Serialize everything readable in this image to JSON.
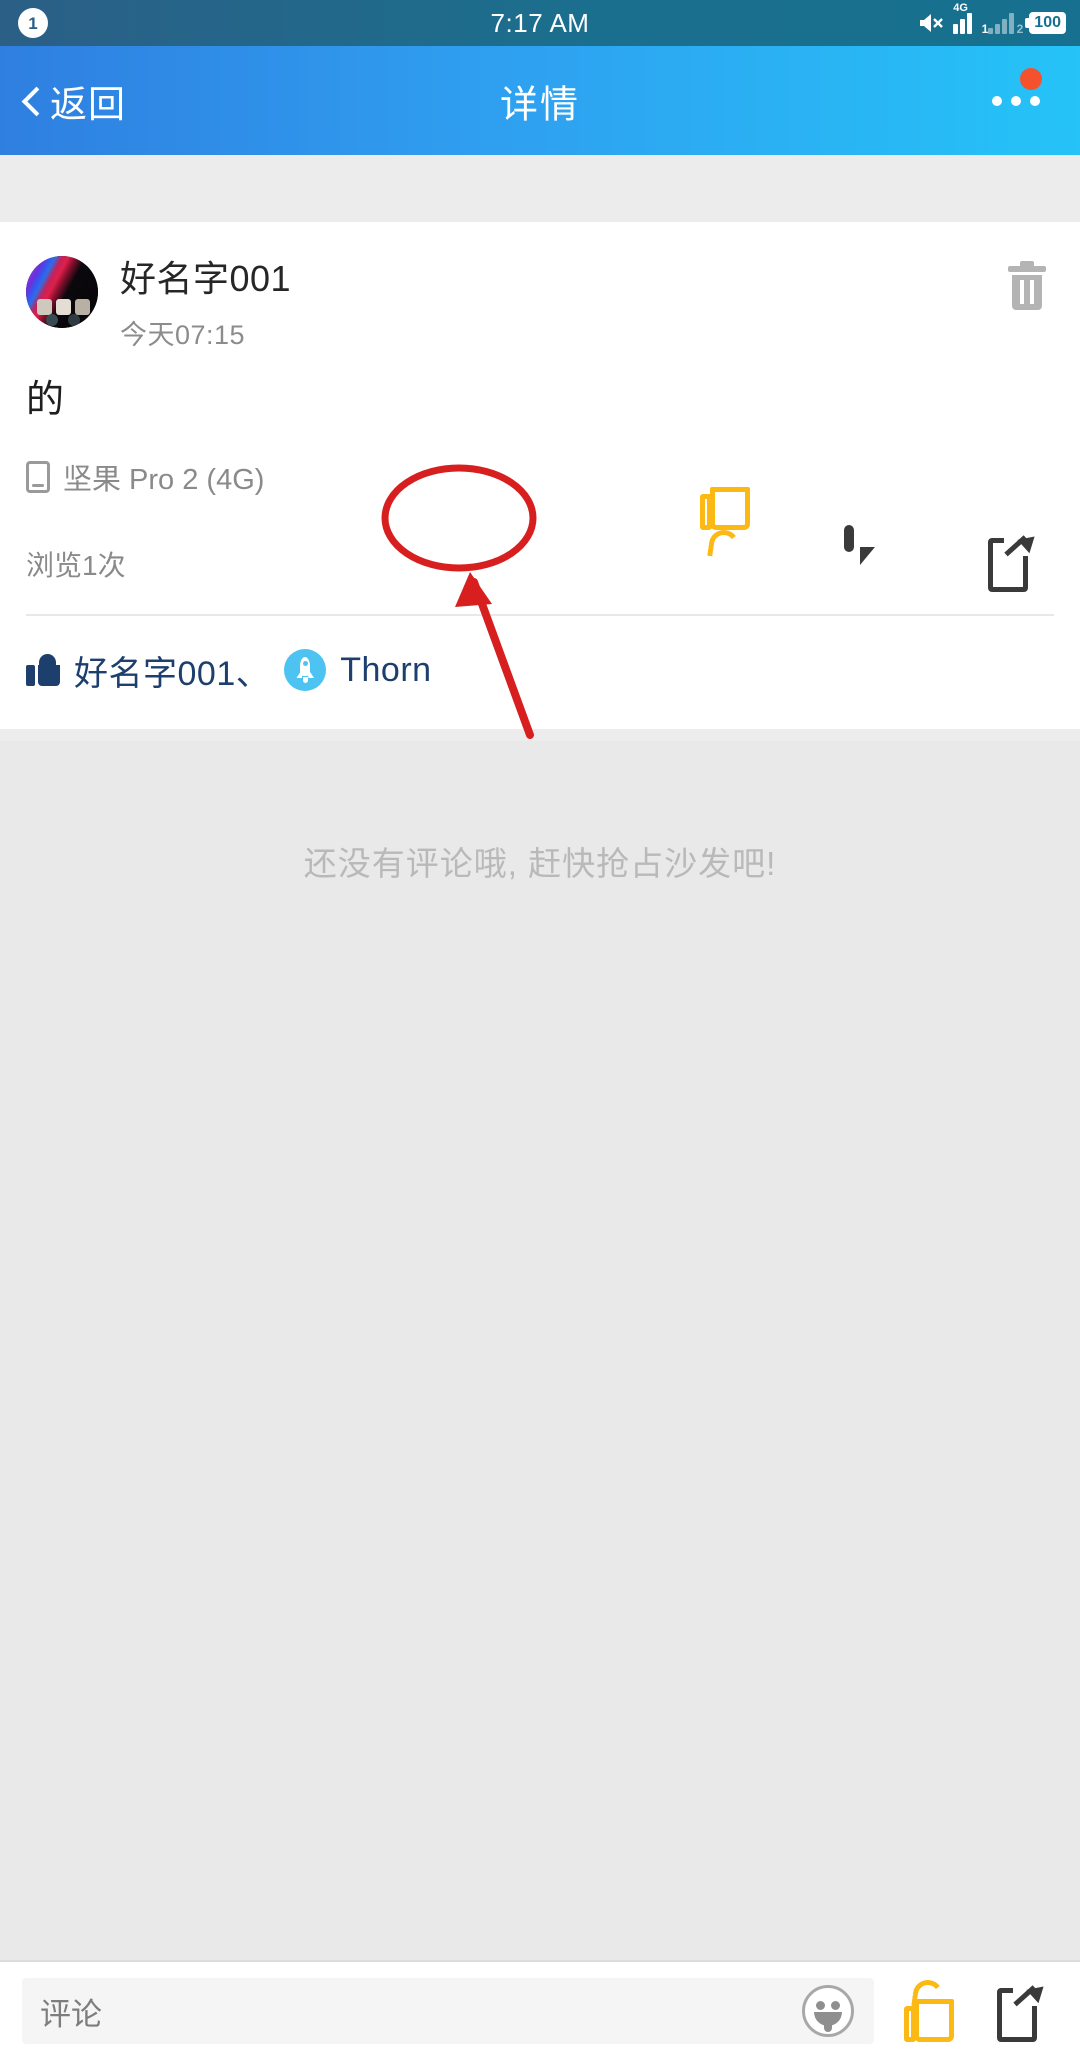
{
  "status_bar": {
    "notification_count": "1",
    "time": "7:17 AM",
    "mute_icon": "speaker-mute-icon",
    "sim1_network": "4G",
    "sim1_label": "1",
    "sim2_label": "2",
    "battery": "100"
  },
  "nav_bar": {
    "back_label": "返回",
    "title": "详情",
    "more_icon": "more-dots-icon",
    "has_red_dot": true,
    "gradient_from": "#2f7fe0",
    "gradient_to": "#25c3f7"
  },
  "post": {
    "author": "好名字001",
    "time": "今天07:15",
    "content": "的",
    "device": "坚果 Pro 2 (4G)",
    "views": "浏览1次",
    "delete_icon": "trash-icon",
    "actions": [
      {
        "name": "like",
        "icon": "thumbs-up-icon",
        "color": "#FDB913"
      },
      {
        "name": "comment",
        "icon": "comment-bubble-icon",
        "color": "#3a3a3a"
      },
      {
        "name": "share",
        "icon": "share-icon",
        "color": "#3a3a3a"
      }
    ],
    "likers": {
      "icon": "thumbs-up-icon",
      "first": "好名字001、",
      "badge_icon": "rocket-badge-icon",
      "second": "Thorn",
      "text_color": "#1d3f6e"
    }
  },
  "comments": {
    "empty_text": "还没有评论哦, 赶快抢占沙发吧!"
  },
  "annotations": {
    "ellipse_color": "#d81f1f",
    "arrow_color": "#d81f1f"
  },
  "bottom_bar": {
    "comment_placeholder": "评论",
    "emoji_icon": "emoji-tongue-icon",
    "like_icon": "thumbs-up-icon",
    "share_icon": "share-icon",
    "like_color": "#FDB913"
  }
}
